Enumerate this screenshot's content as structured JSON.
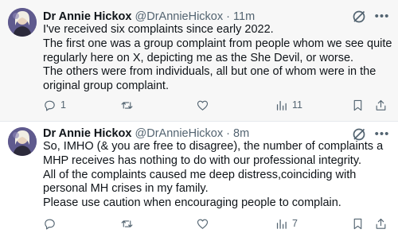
{
  "tweets": [
    {
      "name": "Dr Annie Hickox",
      "handle": "@DrAnnieHickox",
      "dot": "·",
      "time": "11m",
      "lines": [
        "I've received six complaints since early 2022.",
        "The first one was a group complaint from people whom we see quite regularly here on X, depicting me as the She Devil, or worse.",
        "The others were from individuals, all but one of whom were in the original group complaint."
      ],
      "actions": {
        "replies": "1",
        "reposts": "",
        "likes": "",
        "views": "11"
      }
    },
    {
      "name": "Dr Annie Hickox",
      "handle": "@DrAnnieHickox",
      "dot": "·",
      "time": "8m",
      "lines": [
        "So, IMHO (& you are free to disagree), the number of complaints a MHP receives has nothing to do with our professional integrity.",
        "All of the complaints caused me deep distress,coinciding with personal MH crises in my family.",
        "Please use caution when encouraging people to complain."
      ],
      "actions": {
        "replies": "",
        "reposts": "",
        "likes": "",
        "views": "7"
      }
    }
  ],
  "icons": {
    "more": "more-icon",
    "grok": "grok-icon",
    "reply": "reply-icon",
    "repost": "repost-icon",
    "like": "like-icon",
    "views": "views-icon",
    "bookmark": "bookmark-icon",
    "share": "share-icon"
  },
  "colors": {
    "text": "#0f1419",
    "secondary": "#536471",
    "selected_bg": "#f7f7f7"
  }
}
